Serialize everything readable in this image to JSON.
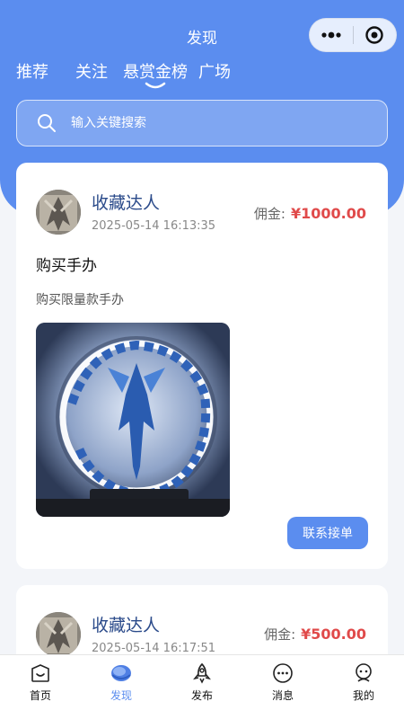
{
  "header": {
    "title": "发现"
  },
  "capsule": {
    "menu_icon": "more-dots-icon",
    "close_icon": "target-close-icon"
  },
  "tabs": [
    {
      "label": "推荐"
    },
    {
      "label": "关注"
    },
    {
      "label": "悬赏金榜",
      "active": true
    },
    {
      "label": "广场"
    }
  ],
  "search": {
    "placeholder": "输入关键搜索"
  },
  "posts": [
    {
      "user": "收藏达人",
      "time": "2025-05-14 16:13:35",
      "reward_label": "佣金:",
      "reward_amount": "¥1000.00",
      "title": "购买手办",
      "desc": "购买限量款手办",
      "action": "联系接单"
    },
    {
      "user": "收藏达人",
      "time": "2025-05-14 16:17:51",
      "reward_label": "佣金:",
      "reward_amount": "¥500.00"
    }
  ],
  "tabbar": [
    {
      "label": "首页",
      "icon": "home-icon"
    },
    {
      "label": "发现",
      "icon": "discover-icon",
      "active": true
    },
    {
      "label": "发布",
      "icon": "rocket-icon"
    },
    {
      "label": "消息",
      "icon": "message-icon"
    },
    {
      "label": "我的",
      "icon": "profile-icon"
    }
  ],
  "colors": {
    "primary": "#5b8def",
    "price": "#e04a4a"
  }
}
